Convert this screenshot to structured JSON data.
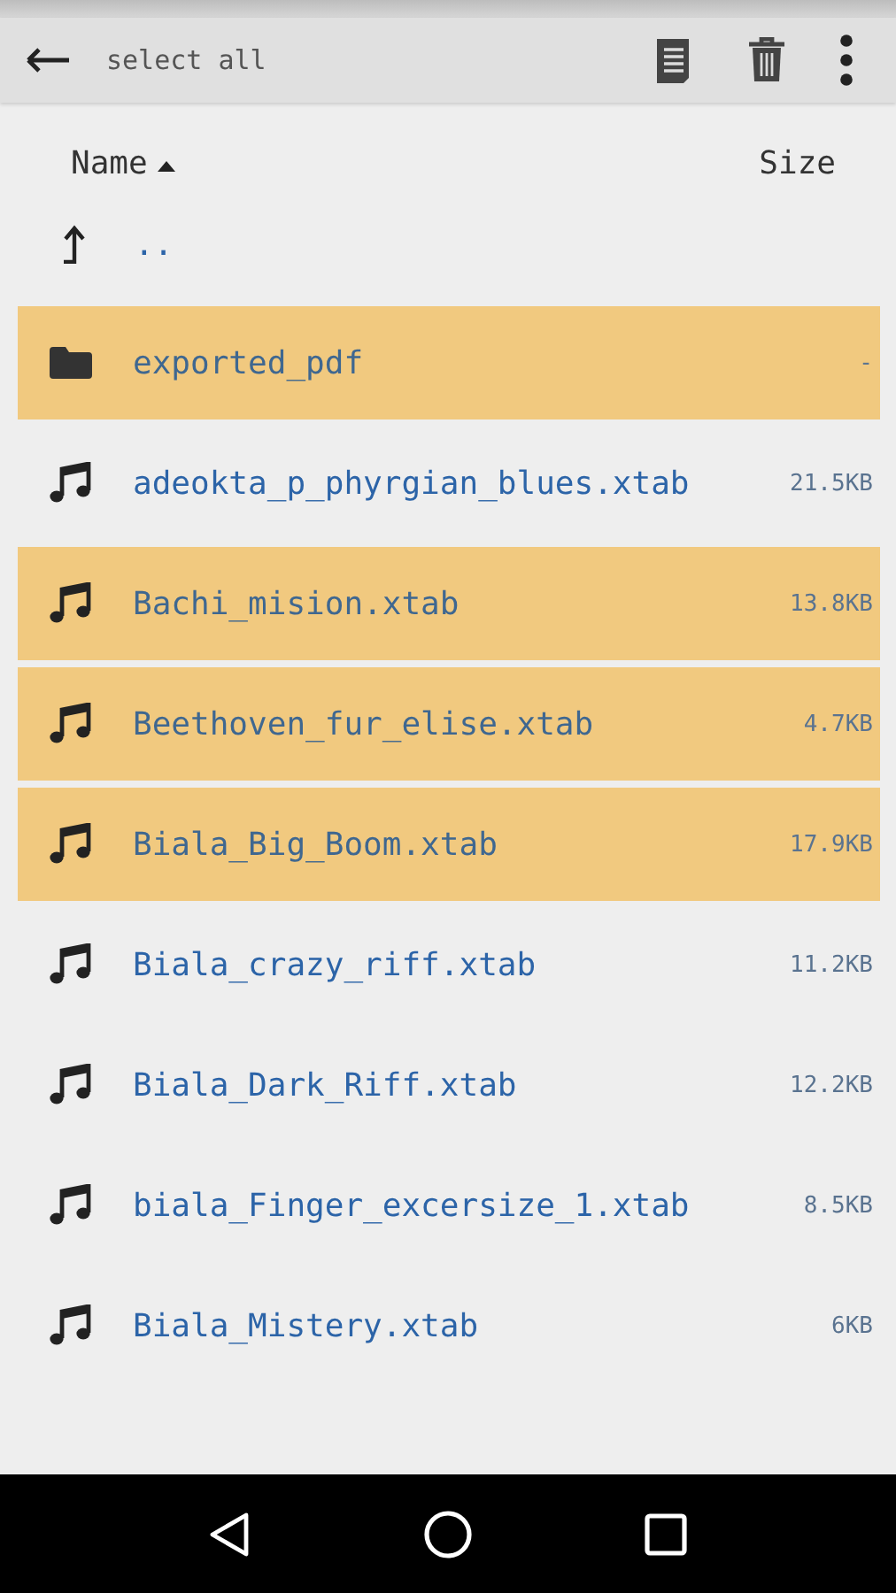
{
  "toolbar": {
    "title": "select all"
  },
  "header": {
    "name": "Name",
    "size": "Size",
    "sort_ascending": true
  },
  "parent": {
    "label": ".."
  },
  "files": [
    {
      "kind": "folder",
      "name": "exported_pdf",
      "size": "-",
      "selected": true
    },
    {
      "kind": "music",
      "name": "adeokta_p_phyrgian_blues.xtab",
      "size": "21.5KB",
      "selected": false
    },
    {
      "kind": "music",
      "name": "Bachi_mision.xtab",
      "size": "13.8KB",
      "selected": true
    },
    {
      "kind": "music",
      "name": "Beethoven_fur_elise.xtab",
      "size": "4.7KB",
      "selected": true
    },
    {
      "kind": "music",
      "name": "Biala_Big_Boom.xtab",
      "size": "17.9KB",
      "selected": true
    },
    {
      "kind": "music",
      "name": "Biala_crazy_riff.xtab",
      "size": "11.2KB",
      "selected": false
    },
    {
      "kind": "music",
      "name": "Biala_Dark_Riff.xtab",
      "size": "12.2KB",
      "selected": false
    },
    {
      "kind": "music",
      "name": "biala_Finger_excersize_1.xtab",
      "size": "8.5KB",
      "selected": false
    },
    {
      "kind": "music",
      "name": "Biala_Mistery.xtab",
      "size": "6KB",
      "selected": false
    }
  ]
}
